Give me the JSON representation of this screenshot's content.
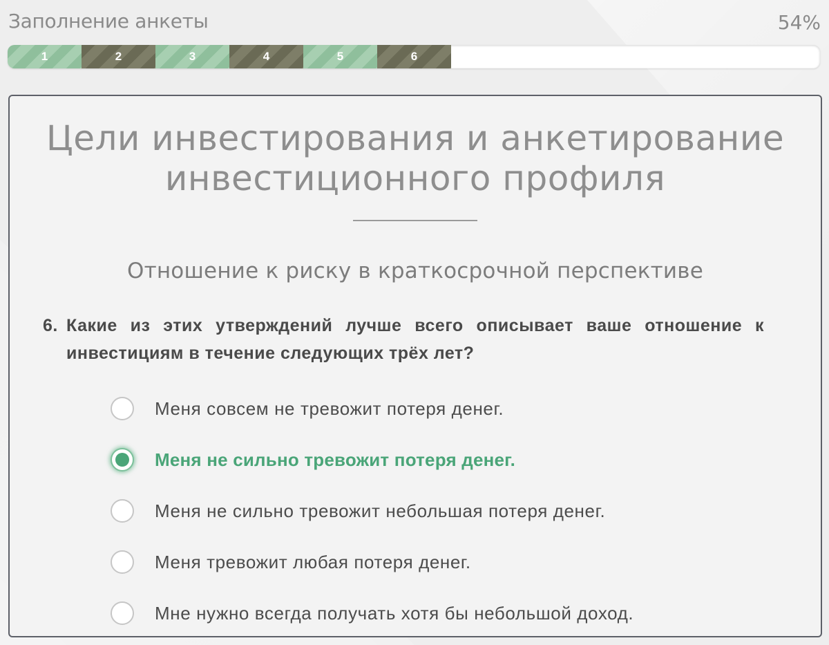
{
  "header": {
    "title": "Заполнение анкеты",
    "percent": "54%"
  },
  "progress": {
    "value_percent": 54,
    "steps": [
      {
        "label": "1",
        "shade": "light"
      },
      {
        "label": "2",
        "shade": "dark"
      },
      {
        "label": "3",
        "shade": "light"
      },
      {
        "label": "4",
        "shade": "dark"
      },
      {
        "label": "5",
        "shade": "light"
      },
      {
        "label": "6",
        "shade": "dark"
      }
    ]
  },
  "card": {
    "title_line1": "Цели инвестирования и анкетирование",
    "title_line2": "инвестиционного профиля",
    "subtitle": "Отношение к риску в краткосрочной перспективе",
    "question": {
      "number": "6.",
      "text": "Какие из этих утверждений лучше всего описывает ваше отношение к инвестициям в течение следующих трёх лет?"
    },
    "options": [
      {
        "label": "Меня совсем не тревожит потеря денег.",
        "selected": false
      },
      {
        "label": "Меня не сильно тревожит потеря денег.",
        "selected": true
      },
      {
        "label": "Меня не сильно тревожит небольшая потеря денег.",
        "selected": false
      },
      {
        "label": "Меня тревожит любая потеря денег.",
        "selected": false
      },
      {
        "label": "Мне нужно всегда получать хотя бы небольшой доход.",
        "selected": false
      }
    ]
  },
  "colors": {
    "accent_green": "#4aa578",
    "progress_light": "#8fbf9c",
    "progress_dark": "#6a6a55",
    "card_border": "#5d6068"
  }
}
